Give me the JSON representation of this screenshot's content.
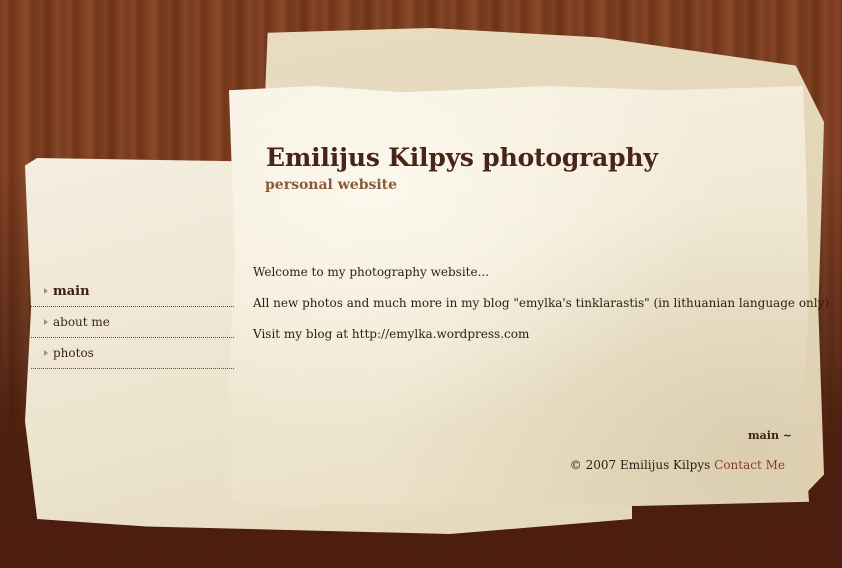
{
  "header": {
    "title": "Emilijus Kilpys photography",
    "subtitle": "personal website"
  },
  "nav": {
    "items": [
      {
        "label": "main",
        "active": true
      },
      {
        "label": "about me",
        "active": false
      },
      {
        "label": "photos",
        "active": false
      }
    ]
  },
  "content": {
    "paragraphs": [
      "Welcome to my photography website...",
      "All new photos and much more in my blog \"emylka's tinklarastis\" (in lithuanian language only)",
      "Visit my blog at http://emylka.wordpress.com"
    ]
  },
  "breadcrumb": "main ~",
  "footer": {
    "copyright": "© 2007 Emilijus Kilpys",
    "contact_label": "Contact Me"
  },
  "colors": {
    "title": "#4a2416",
    "subtitle": "#8a5a3a",
    "link": "#8a3d24",
    "wood": "#7a3c1f"
  },
  "icons": {
    "nav_bullet": "triangle-right-icon"
  }
}
